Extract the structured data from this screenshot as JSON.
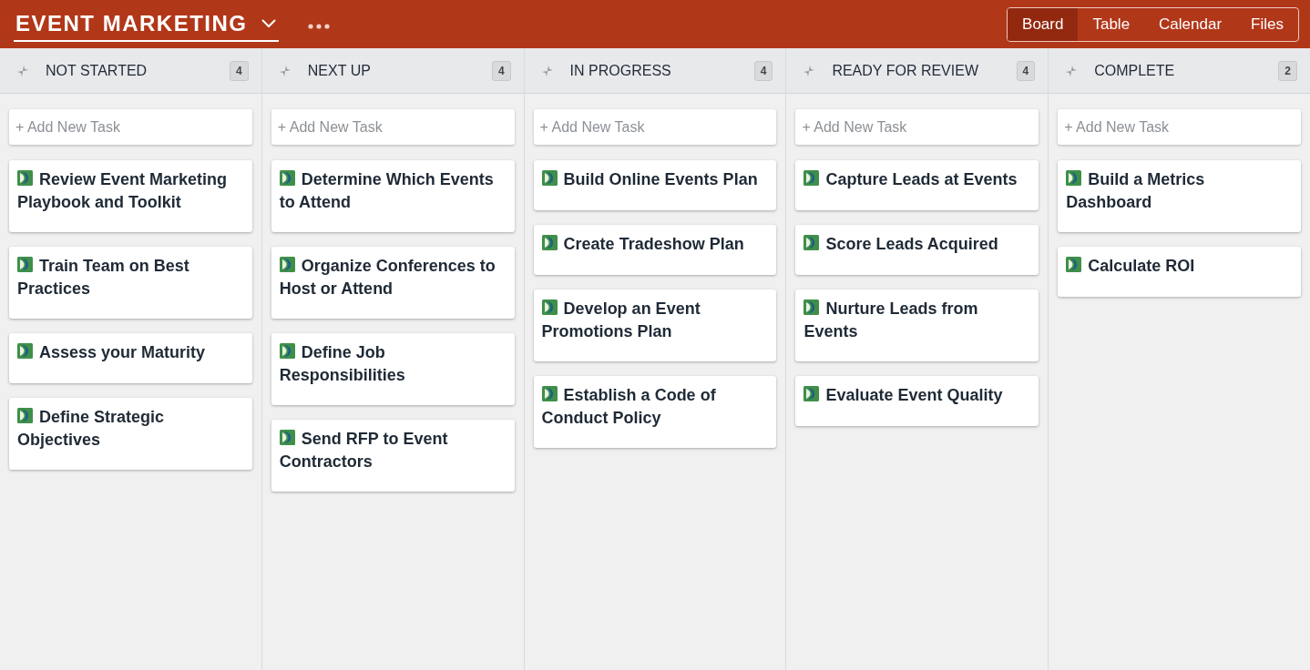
{
  "project": {
    "title": "EVENT MARKETING"
  },
  "views": [
    {
      "label": "Board",
      "selected": true
    },
    {
      "label": "Table",
      "selected": false
    },
    {
      "label": "Calendar",
      "selected": false
    },
    {
      "label": "Files",
      "selected": false
    }
  ],
  "columns": [
    {
      "title": "NOT STARTED",
      "count": "4",
      "add_placeholder": "+ Add New Task",
      "tasks": [
        "Review Event Marketing Playbook and Toolkit",
        "Train Team on Best Practices",
        "Assess your Maturity",
        "Define Strategic Objectives"
      ]
    },
    {
      "title": "NEXT UP",
      "count": "4",
      "add_placeholder": "+ Add New Task",
      "tasks": [
        "Determine Which Events to Attend",
        "Organize Conferences to Host or Attend",
        "Define Job Responsibilities",
        "Send RFP to Event Contractors"
      ]
    },
    {
      "title": "IN PROGRESS",
      "count": "4",
      "add_placeholder": "+ Add New Task",
      "tasks": [
        "Build Online Events Plan",
        "Create Tradeshow Plan",
        "Develop an Event Promotions Plan",
        "Establish a Code of Conduct Policy"
      ]
    },
    {
      "title": "READY FOR REVIEW",
      "count": "4",
      "add_placeholder": "+ Add New Task",
      "tasks": [
        "Capture Leads at Events",
        "Score Leads Acquired",
        "Nurture Leads from Events",
        "Evaluate Event Quality"
      ]
    },
    {
      "title": "COMPLETE",
      "count": "2",
      "add_placeholder": "+ Add New Task",
      "tasks": [
        "Build a Metrics Dashboard",
        "Calculate ROI"
      ]
    }
  ]
}
